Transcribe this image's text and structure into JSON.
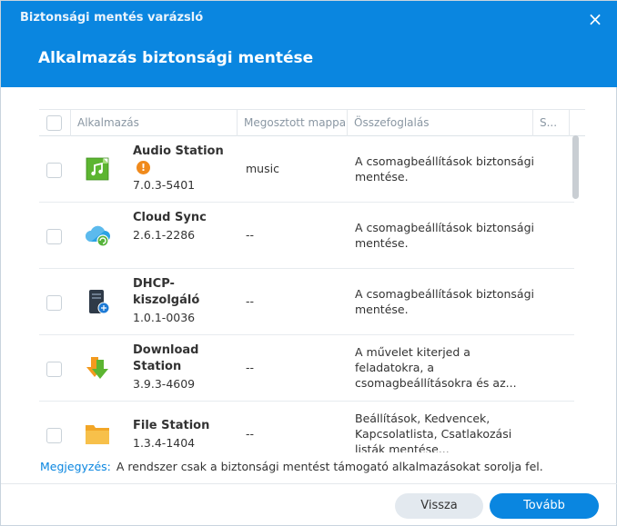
{
  "window": {
    "title": "Biztonsági mentés varázsló",
    "close_icon": "×"
  },
  "step": {
    "title": "Alkalmazás biztonsági mentése"
  },
  "table": {
    "columns": [
      "Alkalmazás",
      "Megosztott mappa",
      "Összefoglalás",
      "S..."
    ],
    "rows": [
      {
        "name": "Audio Station",
        "version": "7.0.3-5401",
        "share": "music",
        "summary": "A csomagbeállítások biztonsági mentése.",
        "warning": "!",
        "icon": "audio-station-icon"
      },
      {
        "name": "Cloud Sync",
        "version": "2.6.1-2286",
        "share": "--",
        "summary": "A csomagbeállítások biztonsági mentése.",
        "icon": "cloud-sync-icon"
      },
      {
        "name": "DHCP-kiszolgáló",
        "version": "1.0.1-0036",
        "share": "--",
        "summary": "A csomagbeállítások biztonsági mentése.",
        "icon": "dhcp-server-icon"
      },
      {
        "name": "Download Station",
        "version": "3.9.3-4609",
        "share": "--",
        "summary": "A művelet kiterjed a feladatokra, a csomagbeállításokra és az...",
        "icon": "download-station-icon"
      },
      {
        "name": "File Station",
        "version": "1.3.4-1404",
        "share": "--",
        "summary": "Beállítások, Kedvencek, Kapcsolatlista, Csatlakozási listák mentése...",
        "icon": "file-station-icon"
      }
    ]
  },
  "note": {
    "label": "Megjegyzés:",
    "text": "A rendszer csak a biztonsági mentést támogató alkalmazásokat sorolja fel."
  },
  "buttons": {
    "back": "Vissza",
    "next": "Tovább"
  },
  "colors": {
    "accent": "#0a86e0",
    "warning": "#f08a1c"
  }
}
